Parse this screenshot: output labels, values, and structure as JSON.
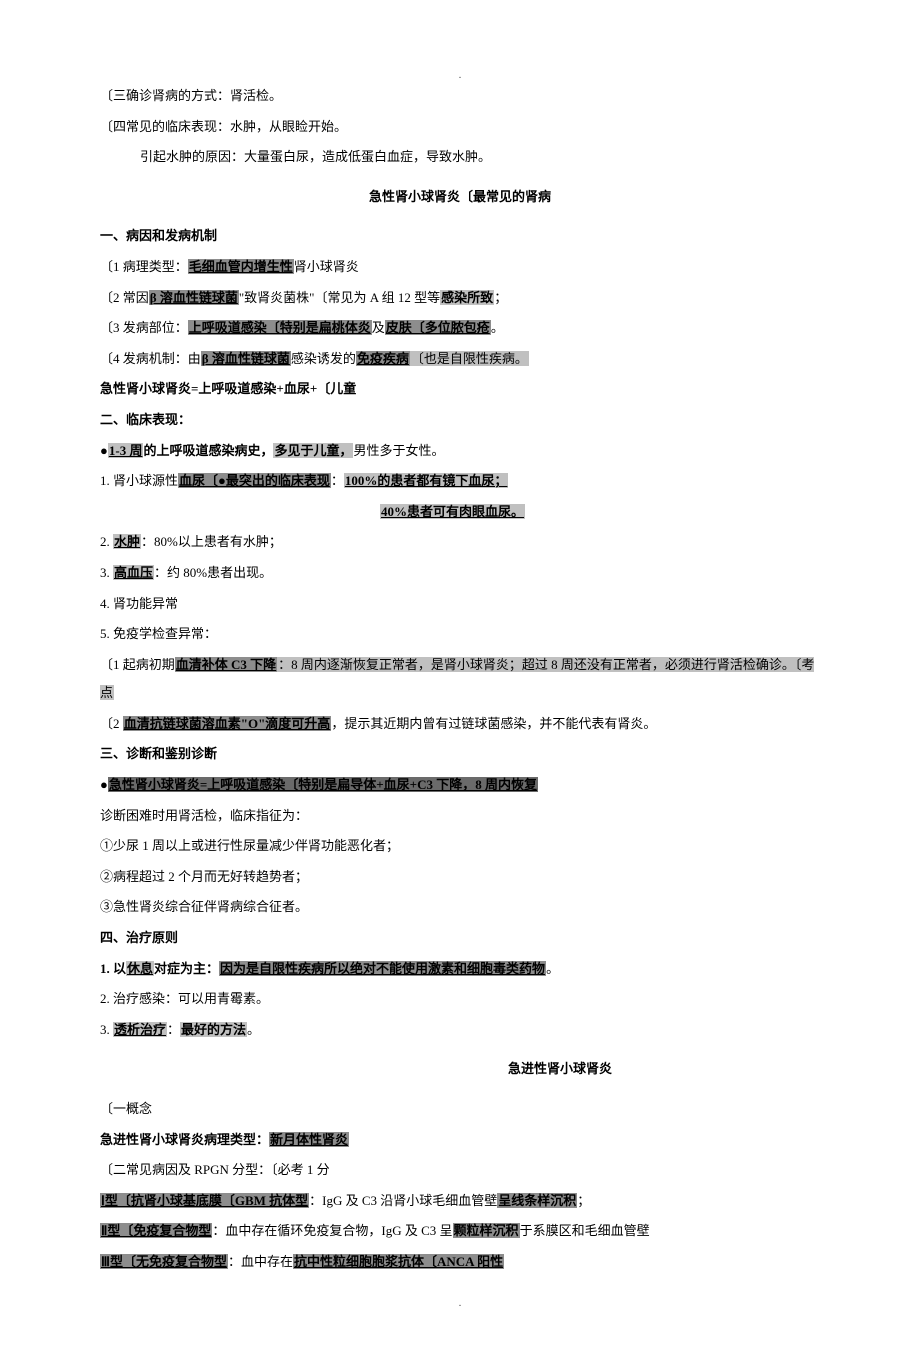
{
  "dot": ".",
  "p1": "〔三确诊肾病的方式：肾活检。",
  "p2": "〔四常见的临床表现：水肿，从眼睑开始。",
  "p3": "引起水肿的原因：大量蛋白尿，造成低蛋白血症，导致水肿。",
  "title1": "急性肾小球肾炎〔最常见的肾病",
  "s1_head": "一、病因和发病机制",
  "s1_1a": "〔1 病理类型：",
  "s1_1b": "毛细血管内增生性",
  "s1_1c": "肾小球肾炎",
  "s1_2a": "〔2 常因",
  "s1_2b": "β 溶血性链球菌",
  "s1_2c": "\"致肾炎菌株\"〔常见为 A 组 12 型等",
  "s1_2d": "感染所致",
  "s1_2e": "；",
  "s1_3a": "〔3 发病部位：",
  "s1_3b": "上呼吸道感染〔特别是扁桃体炎",
  "s1_3c": "及",
  "s1_3d": "皮肤〔多位脓包疮",
  "s1_3e": "。",
  "s1_4a": "〔4 发病机制：由",
  "s1_4b": "β 溶血性链球菌",
  "s1_4c": "感染诱发的",
  "s1_4d": "免疫疾病",
  "s1_4e": "〔也是自限性疾病。",
  "s1_eq": "急性肾小球肾炎=上呼吸道感染+血尿+〔儿童",
  "s2_head": "二、临床表现：",
  "s2_1a": "●",
  "s2_1b": "1-3 周",
  "s2_1c": "的上呼吸道感染病史，",
  "s2_1d": "多见于儿童，",
  "s2_1e": "男性多于女性。",
  "s2_2a": "1. 肾小球源性",
  "s2_2b": "血尿〔●最突出的临床表现",
  "s2_2c": "：",
  "s2_2d": "100%的患者都有镜下血尿；",
  "s2_3": "40%患者可有肉眼血尿。",
  "s2_4a": "2. ",
  "s2_4b": "水肿",
  "s2_4c": "：80%以上患者有水肿；",
  "s2_5a": "3. ",
  "s2_5b": "高血压",
  "s2_5c": "：约 80%患者出现。",
  "s2_6": "4. 肾功能异常",
  "s2_7": "5. 免疫学检查异常：",
  "s2_8a": "〔1 起病初期",
  "s2_8b": "血清补体 C3 下降",
  "s2_8c": "：8 周内逐渐恢复正常者，是肾小球肾炎；超过 8 周还没有正常者，必须进行肾活检确诊。〔考点",
  "s2_9a": "〔2 ",
  "s2_9b": "血清抗链球菌溶血素\"O\"滴度可升高",
  "s2_9c": "，提示其近期内曾有过链球菌感染，并不能代表有肾炎。",
  "s3_head": "三、诊断和鉴别诊断",
  "s3_1a": "●",
  "s3_1b": "急性肾小球肾炎=上呼吸道感染〔特别是扁导体+血尿+C3 下降，8 周内恢复",
  "s3_2": "诊断困难时用肾活检，临床指征为：",
  "s3_3": "①少尿 1 周以上或进行性尿量减少伴肾功能恶化者；",
  "s3_4": "②病程超过 2 个月而无好转趋势者；",
  "s3_5": "③急性肾炎综合征伴肾病综合征者。",
  "s4_head": "四、治疗原则",
  "s4_1a": "1. 以",
  "s4_1b": "休息",
  "s4_1c": "对症为主：",
  "s4_1d": "因为是自限性疾病所以绝对不能使用激素和细胞毒类药物",
  "s4_1e": "。",
  "s4_2": "2. 治疗感染：可以用青霉素。",
  "s4_3a": "3. ",
  "s4_3b": "透析治疗",
  "s4_3c": "：",
  "s4_3d": "最好的方法",
  "s4_3e": "。",
  "title2": "急进性肾小球肾炎",
  "c1": "〔一概念",
  "c2a": "急进性肾小球肾炎病理类型：",
  "c2b": "新月体性肾炎",
  "c3": "〔二常见病因及 RPGN 分型：〔必考 1 分",
  "c4a": "Ⅰ型〔抗肾小球基底膜〔GBM 抗体型",
  "c4b": "：IgG 及 C3 沿肾小球毛细血管壁",
  "c4c": "呈线条样沉积",
  "c4d": "；",
  "c5a": "Ⅱ型〔免疫复合物型",
  "c5b": "：血中存在循环免疫复合物，IgG 及 C3 呈",
  "c5c": "颗粒样沉积",
  "c5d": "于系膜区和毛细血管壁",
  "c6a": "Ⅲ型〔无免疫复合物型",
  "c6b": "：血中存在",
  "c6c": "抗中性粒细胞胞浆抗体〔ANCA 阳性"
}
